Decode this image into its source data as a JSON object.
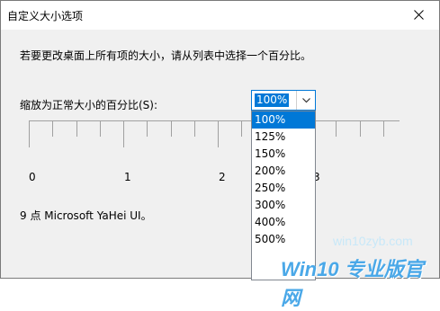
{
  "dialog": {
    "title": "自定义大小选项",
    "close_glyph": "✕",
    "instruction": "若要更改桌面上所有项的大小，请从列表中选择一个百分比。",
    "scale_label": "缩放为正常大小的百分比(S):",
    "font_info": "9 点 Microsoft YaHei UI。"
  },
  "combo": {
    "value": "100%",
    "arrow_icon": "chevron-down-icon"
  },
  "dropdown": {
    "options": [
      "100%",
      "125%",
      "150%",
      "200%",
      "250%",
      "300%",
      "400%",
      "500%"
    ],
    "selected": "100%"
  },
  "ruler": {
    "labels": [
      "0",
      "1",
      "2",
      "3"
    ]
  },
  "watermark": {
    "small": "win10zyb.com",
    "big": "Win10 专业版官网"
  },
  "colors": {
    "accent": "#0078d7",
    "content_bg": "#f0f0f0",
    "watermark": "#4aa8e8"
  }
}
